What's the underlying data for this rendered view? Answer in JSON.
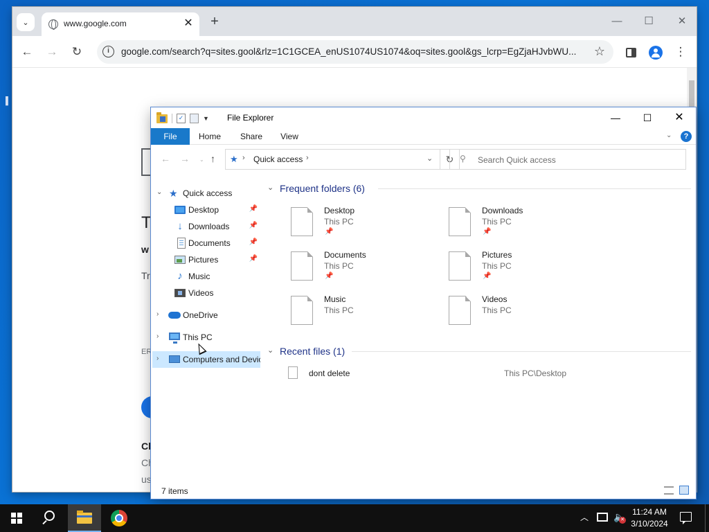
{
  "chrome": {
    "tab_title": "www.google.com",
    "address_url": "google.com/search?q=sites.gool&rlz=1C1GCEA_enUS1074US1074&oq=sites.gool&gs_lcrp=EgZjaHJvbWU...",
    "page_fragments": {
      "t": "T",
      "w": "w",
      "try": "Try",
      "er": "ER",
      "ch": "Ch",
      "ch2": "Ch",
      "us": "us"
    }
  },
  "explorer": {
    "title": "File Explorer",
    "ribbon": {
      "file": "File",
      "home": "Home",
      "share": "Share",
      "view": "View"
    },
    "address": {
      "crumb": "Quick access"
    },
    "search_placeholder": "Search Quick access",
    "sidebar": {
      "quick_access": "Quick access",
      "items": [
        {
          "label": "Desktop",
          "pinned": true
        },
        {
          "label": "Downloads",
          "pinned": true
        },
        {
          "label": "Documents",
          "pinned": true
        },
        {
          "label": "Pictures",
          "pinned": true
        },
        {
          "label": "Music",
          "pinned": false
        },
        {
          "label": "Videos",
          "pinned": false
        }
      ],
      "onedrive": "OneDrive",
      "this_pc": "This PC",
      "network": "Computers and Devices"
    },
    "frequent": {
      "heading": "Frequent folders (6)",
      "folders": [
        {
          "name": "Desktop",
          "location": "This PC",
          "pinned": true
        },
        {
          "name": "Downloads",
          "location": "This PC",
          "pinned": true
        },
        {
          "name": "Documents",
          "location": "This PC",
          "pinned": true
        },
        {
          "name": "Pictures",
          "location": "This PC",
          "pinned": true
        },
        {
          "name": "Music",
          "location": "This PC",
          "pinned": false
        },
        {
          "name": "Videos",
          "location": "This PC",
          "pinned": false
        }
      ]
    },
    "recent": {
      "heading": "Recent files (1)",
      "files": [
        {
          "name": "dont delete",
          "path": "This PC\\Desktop"
        }
      ]
    },
    "status": {
      "count": "7 items"
    }
  },
  "taskbar": {
    "time": "11:24 AM",
    "date": "3/10/2024"
  },
  "colors": {
    "accent": "#1979ca",
    "desktop": "#0a73d6",
    "taskbar": "#101010"
  }
}
